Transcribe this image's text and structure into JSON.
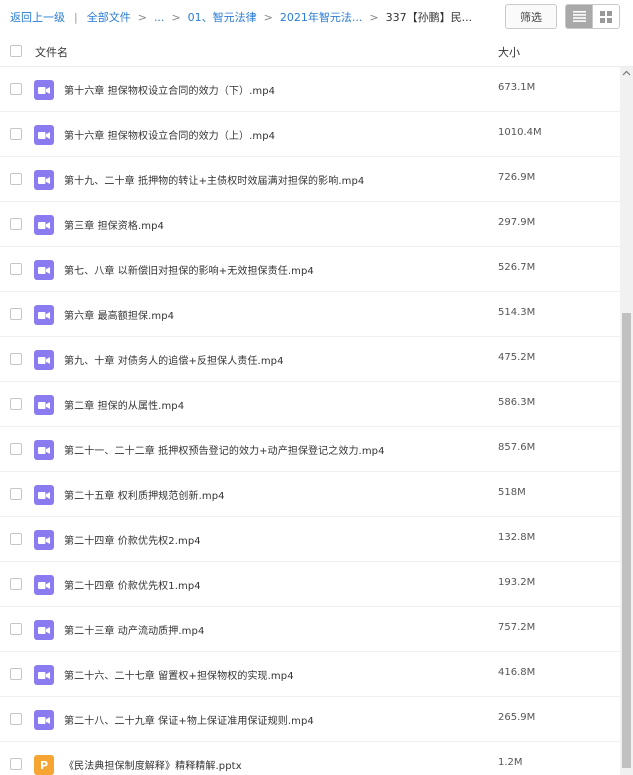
{
  "breadcrumb": {
    "back": "返回上一级",
    "sep": "|",
    "all_files": "全部文件",
    "ellipsis": "...",
    "level1": "01、智元法律",
    "level2": "2021年智元法...",
    "current": "337【孙鹏】民..."
  },
  "toolbar": {
    "filter_label": "筛选",
    "view_list": "list-view-icon",
    "view_grid": "grid-view-icon"
  },
  "header": {
    "name_col": "文件名",
    "size_col": "大小"
  },
  "files": [
    {
      "name": "第十六章 担保物权设立合同的效力（下）.mp4",
      "size": "673.1M",
      "type": "video"
    },
    {
      "name": "第十六章 担保物权设立合同的效力（上）.mp4",
      "size": "1010.4M",
      "type": "video"
    },
    {
      "name": "第十九、二十章 抵押物的转让+主债权时效届满对担保的影响.mp4",
      "size": "726.9M",
      "type": "video"
    },
    {
      "name": "第三章 担保资格.mp4",
      "size": "297.9M",
      "type": "video"
    },
    {
      "name": "第七、八章 以新偿旧对担保的影响+无效担保责任.mp4",
      "size": "526.7M",
      "type": "video"
    },
    {
      "name": "第六章 最高额担保.mp4",
      "size": "514.3M",
      "type": "video"
    },
    {
      "name": "第九、十章 对债务人的追偿+反担保人责任.mp4",
      "size": "475.2M",
      "type": "video"
    },
    {
      "name": "第二章 担保的从属性.mp4",
      "size": "586.3M",
      "type": "video"
    },
    {
      "name": "第二十一、二十二章 抵押权预告登记的效力+动产担保登记之效力.mp4",
      "size": "857.6M",
      "type": "video"
    },
    {
      "name": "第二十五章 权利质押规范创新.mp4",
      "size": "518M",
      "type": "video"
    },
    {
      "name": "第二十四章 价款优先权2.mp4",
      "size": "132.8M",
      "type": "video"
    },
    {
      "name": "第二十四章 价款优先权1.mp4",
      "size": "193.2M",
      "type": "video"
    },
    {
      "name": "第二十三章 动产流动质押.mp4",
      "size": "757.2M",
      "type": "video"
    },
    {
      "name": "第二十六、二十七章 留置权+担保物权的实现.mp4",
      "size": "416.8M",
      "type": "video"
    },
    {
      "name": "第二十八、二十九章 保证+物上保证准用保证规则.mp4",
      "size": "265.9M",
      "type": "video"
    },
    {
      "name": "《民法典担保制度解释》精释精解.pptx",
      "size": "1.2M",
      "type": "ppt",
      "icon_letter": "P"
    }
  ],
  "colors": {
    "link": "#2a7cd6",
    "video_icon": "#8a7cf0",
    "ppt_icon": "#f6a532",
    "view_active": "#a9a9a9"
  }
}
